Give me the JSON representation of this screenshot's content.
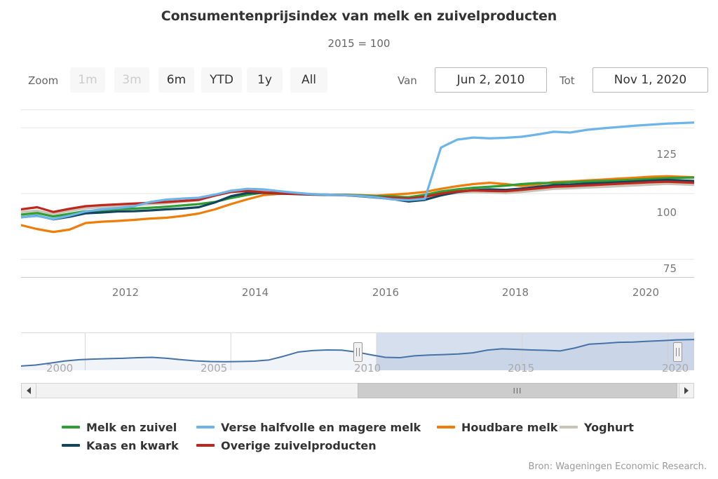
{
  "header": {
    "title": "Consumentenprijsindex van melk en zuivelproducten",
    "subtitle": "2015 = 100"
  },
  "range_selector": {
    "zoom_label": "Zoom",
    "buttons": [
      {
        "label": "1m",
        "selected": false,
        "disabled": true
      },
      {
        "label": "3m",
        "selected": false,
        "disabled": true
      },
      {
        "label": "6m",
        "selected": false,
        "disabled": false
      },
      {
        "label": "YTD",
        "selected": false,
        "disabled": false
      },
      {
        "label": "1y",
        "selected": false,
        "disabled": false
      },
      {
        "label": "All",
        "selected": false,
        "disabled": false
      }
    ],
    "from_label": "Van",
    "from_value": "Jun 2, 2010",
    "to_label": "Tot",
    "to_value": "Nov 1, 2020"
  },
  "navigator": {
    "xlabels": [
      "2000",
      "2005",
      "2010",
      "2015",
      "2020"
    ],
    "selected_from": "2010",
    "selected_to": "2020",
    "scroll_grip": "III",
    "left_arrow": "◀",
    "right_arrow": "▶"
  },
  "legend": {
    "rows": [
      [
        {
          "label": "Melk en zuivel",
          "color": "#2f9e34"
        },
        {
          "label": "Verse halfvolle en magere melk",
          "color": "#6cb4ea"
        },
        {
          "label": "Houdbare melk",
          "color": "#ef7d09"
        },
        {
          "label": "Yoghurt",
          "color": "#c9c4b8"
        }
      ],
      [
        {
          "label": "Kaas en kwark",
          "color": "#13455f"
        },
        {
          "label": "Overige zuivelproducten",
          "color": "#c0271c"
        }
      ]
    ]
  },
  "credits": "Bron: Wageningen Economic Research.",
  "chart_data": {
    "type": "line",
    "title": "Consumentenprijsindex van melk en zuivelproducten",
    "subtitle": "2015 = 100",
    "xlabel": "",
    "ylabel": "",
    "xlim": [
      2010.42,
      2020.84
    ],
    "ylim": [
      68,
      132
    ],
    "yticks": [
      75,
      100,
      125
    ],
    "xticks": [
      2012,
      2014,
      2016,
      2018,
      2020
    ],
    "grid": true,
    "legend_position": "bottom",
    "x": [
      2010.42,
      2010.67,
      2010.92,
      2011.17,
      2011.42,
      2011.67,
      2011.92,
      2012.17,
      2012.42,
      2012.67,
      2012.92,
      2013.17,
      2013.42,
      2013.67,
      2013.92,
      2014.17,
      2014.42,
      2014.67,
      2014.92,
      2015.17,
      2015.42,
      2015.67,
      2015.92,
      2016.17,
      2016.42,
      2016.67,
      2016.92,
      2017.17,
      2017.42,
      2017.67,
      2017.92,
      2018.17,
      2018.42,
      2018.67,
      2018.92,
      2019.17,
      2019.42,
      2019.67,
      2019.92,
      2020.17,
      2020.42,
      2020.84
    ],
    "series": [
      {
        "name": "Melk en zuivel",
        "color": "#2f9e34",
        "values": [
          92.0,
          92.6,
          91.3,
          92.3,
          93.3,
          93.6,
          94.1,
          94.3,
          94.6,
          95.0,
          95.5,
          96.0,
          96.8,
          98.3,
          99.5,
          100.4,
          100.3,
          100.0,
          99.7,
          99.5,
          99.5,
          99.3,
          99.0,
          98.9,
          98.6,
          99.5,
          100.8,
          101.6,
          102.2,
          102.6,
          103.0,
          103.6,
          104.0,
          104.0,
          104.3,
          104.6,
          104.8,
          105.0,
          105.3,
          105.6,
          105.9,
          106.1
        ]
      },
      {
        "name": "Verse halfvolle en magere melk",
        "color": "#6cb4ea",
        "values": [
          91.0,
          91.5,
          90.3,
          91.6,
          93.2,
          94.0,
          94.5,
          95.2,
          96.8,
          97.7,
          98.1,
          98.4,
          99.6,
          101.0,
          101.8,
          101.6,
          100.9,
          100.3,
          99.8,
          99.6,
          99.4,
          99.1,
          98.6,
          97.8,
          97.5,
          98.0,
          117.5,
          120.5,
          121.3,
          121.0,
          121.2,
          121.6,
          122.5,
          123.5,
          123.2,
          124.2,
          124.8,
          125.3,
          125.8,
          126.2,
          126.6,
          127.0
        ]
      },
      {
        "name": "Houdbare melk",
        "color": "#ef7d09",
        "values": [
          88.0,
          86.5,
          85.4,
          86.3,
          88.8,
          89.3,
          89.6,
          90.0,
          90.5,
          90.8,
          91.5,
          92.4,
          94.0,
          96.0,
          97.8,
          99.4,
          99.9,
          100.0,
          99.8,
          99.6,
          99.6,
          99.4,
          99.2,
          99.6,
          100.0,
          100.6,
          101.8,
          102.8,
          103.6,
          104.1,
          103.6,
          102.9,
          103.5,
          104.4,
          104.6,
          105.0,
          105.3,
          105.7,
          106.0,
          106.4,
          106.6,
          106.2
        ]
      },
      {
        "name": "Yoghurt",
        "color": "#c9c4b8",
        "values": [
          93.0,
          93.5,
          92.2,
          93.4,
          94.4,
          94.8,
          95.2,
          95.5,
          96.0,
          96.3,
          96.9,
          97.4,
          99.5,
          101.2,
          101.6,
          100.8,
          100.2,
          99.9,
          99.6,
          99.5,
          99.3,
          99.0,
          98.6,
          98.3,
          98.0,
          98.6,
          99.5,
          100.2,
          100.6,
          100.4,
          100.2,
          100.6,
          101.2,
          101.8,
          102.0,
          102.3,
          102.5,
          102.8,
          103.1,
          103.4,
          103.7,
          103.3
        ]
      },
      {
        "name": "Kaas en kwark",
        "color": "#13455f",
        "values": [
          91.0,
          91.6,
          90.2,
          91.2,
          92.5,
          92.8,
          93.2,
          93.3,
          93.6,
          94.0,
          94.3,
          94.8,
          96.6,
          99.0,
          100.2,
          100.3,
          100.0,
          99.8,
          99.6,
          99.5,
          99.4,
          99.0,
          98.5,
          97.9,
          97.0,
          97.6,
          99.3,
          100.6,
          101.3,
          101.6,
          101.4,
          101.9,
          102.6,
          103.2,
          103.4,
          103.8,
          104.0,
          104.3,
          104.6,
          104.9,
          105.2,
          104.8
        ]
      },
      {
        "name": "Overige zuivelproducten",
        "color": "#c0271c",
        "values": [
          94.0,
          94.8,
          93.0,
          94.2,
          95.2,
          95.6,
          95.9,
          96.2,
          96.5,
          96.8,
          97.2,
          97.6,
          99.2,
          100.6,
          101.0,
          100.5,
          100.1,
          99.9,
          99.7,
          99.6,
          99.4,
          99.1,
          98.7,
          98.4,
          98.1,
          98.8,
          100.0,
          100.8,
          101.2,
          101.0,
          100.9,
          101.4,
          102.0,
          102.6,
          102.8,
          103.1,
          103.4,
          103.7,
          104.0,
          104.3,
          104.5,
          104.1
        ]
      }
    ],
    "navigator_series": {
      "name": "navigator",
      "color": "#4572a7",
      "xlim": [
        1997.8,
        2020.9
      ],
      "x": [
        1997.8,
        1998.3,
        1998.8,
        1999.3,
        1999.8,
        2000.3,
        2000.8,
        2001.3,
        2001.8,
        2002.3,
        2002.8,
        2003.3,
        2003.8,
        2004.3,
        2004.8,
        2005.3,
        2005.8,
        2006.3,
        2006.8,
        2007.3,
        2007.8,
        2008.3,
        2008.8,
        2009.3,
        2009.8,
        2010.3,
        2010.8,
        2011.3,
        2011.8,
        2012.3,
        2012.8,
        2013.3,
        2013.8,
        2014.3,
        2014.8,
        2015.3,
        2015.8,
        2016.3,
        2016.8,
        2017.3,
        2017.8,
        2018.3,
        2018.8,
        2019.3,
        2019.8,
        2020.3,
        2020.9
      ],
      "values": [
        83.0,
        84.0,
        86.0,
        88.2,
        89.5,
        90.2,
        90.6,
        91.0,
        91.6,
        92.0,
        91.0,
        89.5,
        88.3,
        87.6,
        87.4,
        87.6,
        88.0,
        89.2,
        93.0,
        97.4,
        99.0,
        99.6,
        99.4,
        97.5,
        94.6,
        92.0,
        91.6,
        93.5,
        94.3,
        94.8,
        95.4,
        96.6,
        99.4,
        100.8,
        100.2,
        99.6,
        99.2,
        98.6,
        101.6,
        105.6,
        106.4,
        107.5,
        107.8,
        108.6,
        109.2,
        110.0,
        110.4
      ]
    }
  }
}
